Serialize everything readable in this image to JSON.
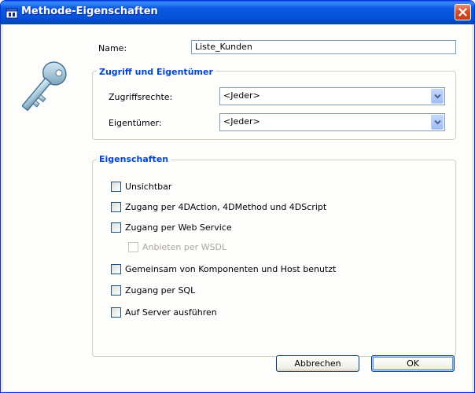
{
  "window": {
    "title": "Methode-Eigenschaften"
  },
  "form": {
    "name_label": "Name:",
    "name_value": "Liste_Kunden"
  },
  "access_group": {
    "title": "Zugriff und Eigentümer",
    "access_label": "Zugriffsrechte:",
    "access_value": "<Jeder>",
    "owner_label": "Eigentümer:",
    "owner_value": "<Jeder>"
  },
  "properties_group": {
    "title": "Eigenschaften",
    "options": [
      {
        "label": "Unsichtbar",
        "checked": false,
        "enabled": true
      },
      {
        "label": "Zugang per 4DAction, 4DMethod und 4DScript",
        "checked": false,
        "enabled": true
      },
      {
        "label": "Zugang per Web Service",
        "checked": false,
        "enabled": true
      },
      {
        "label": "Anbieten per WSDL",
        "checked": false,
        "enabled": false
      },
      {
        "label": "Gemeinsam von Komponenten und Host benutzt",
        "checked": false,
        "enabled": true
      },
      {
        "label": "Zugang per SQL",
        "checked": false,
        "enabled": true
      },
      {
        "label": "Auf Server ausführen",
        "checked": false,
        "enabled": true
      }
    ]
  },
  "buttons": {
    "cancel_label": "Abbrechen",
    "ok_label": "OK"
  },
  "colors": {
    "titlebar": "#0653d9",
    "group_title": "#0046d5",
    "close_button": "#d6502c"
  },
  "icons": {
    "title": "window-icon",
    "close": "close-icon",
    "key": "key-icon",
    "dropdown": "chevron-down-icon"
  }
}
